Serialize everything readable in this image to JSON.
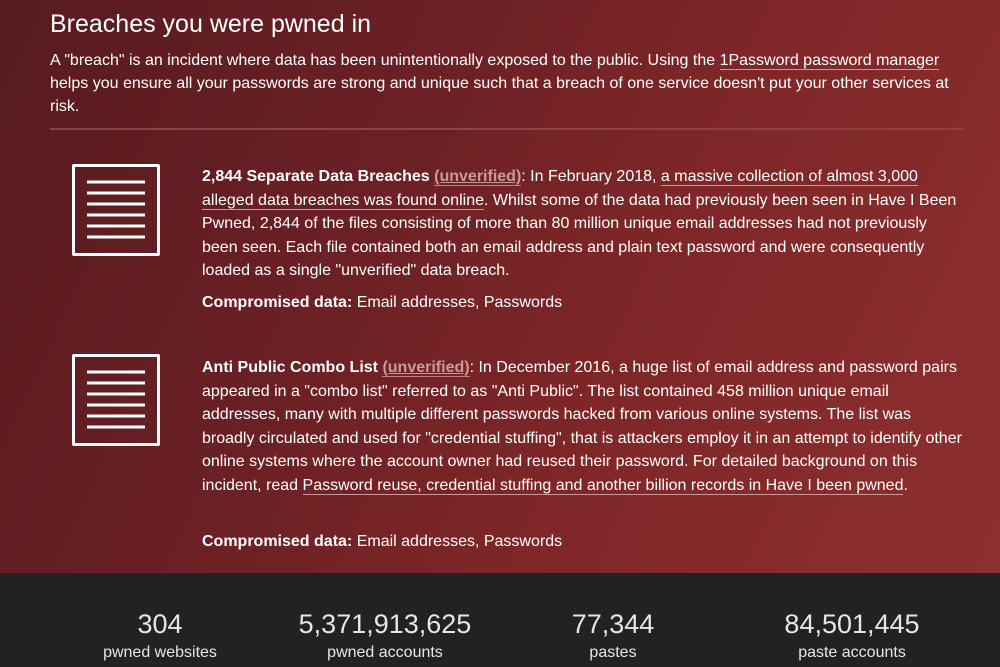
{
  "section": {
    "heading": "Breaches you were pwned in",
    "intro": {
      "before": "A \"breach\" is an incident where data has been unintentionally exposed to the public. Using the ",
      "link": "1Password password manager",
      "after": " helps you ensure all your passwords are strong and unique such that a breach of one service doesn't put your other services at risk."
    }
  },
  "breaches": [
    {
      "icon": "document-lines-icon",
      "title": "2,844 Separate Data Breaches",
      "badge": "(unverified)",
      "text_before": ": In February 2018, ",
      "link": "a massive collection of almost 3,000 alleged data breaches was found online",
      "text_after": ". Whilst some of the data had previously been seen in Have I Been Pwned, 2,844 of the files consisting of more than 80 million unique email addresses had not previously been seen. Each file contained both an email address and plain text password and were consequently loaded as a single \"unverified\" data breach.",
      "compromised_label": "Compromised data:",
      "compromised_value": " Email addresses, Passwords"
    },
    {
      "icon": "document-lines-icon",
      "title": "Anti Public Combo List",
      "badge": "(unverified)",
      "text_before": ": In December 2016, a huge list of email address and password pairs appeared in a \"combo list\" referred to as \"Anti Public\". The list contained 458 million unique email addresses, many with multiple different passwords hacked from various online systems. The list was broadly circulated and used for \"credential stuffing\", that is attackers employ it in an attempt to identify other online systems where the account owner had reused their password. For detailed background on this incident, read ",
      "link": "Password reuse, credential stuffing and another billion records in Have I been pwned",
      "text_after": ".",
      "compromised_label": "Compromised data:",
      "compromised_value": " Email addresses, Passwords"
    }
  ],
  "stats": [
    {
      "value": "304",
      "label": "pwned websites"
    },
    {
      "value": "5,371,913,625",
      "label": "pwned accounts"
    },
    {
      "value": "77,344",
      "label": "pastes"
    },
    {
      "value": "84,501,445",
      "label": "paste accounts"
    }
  ]
}
